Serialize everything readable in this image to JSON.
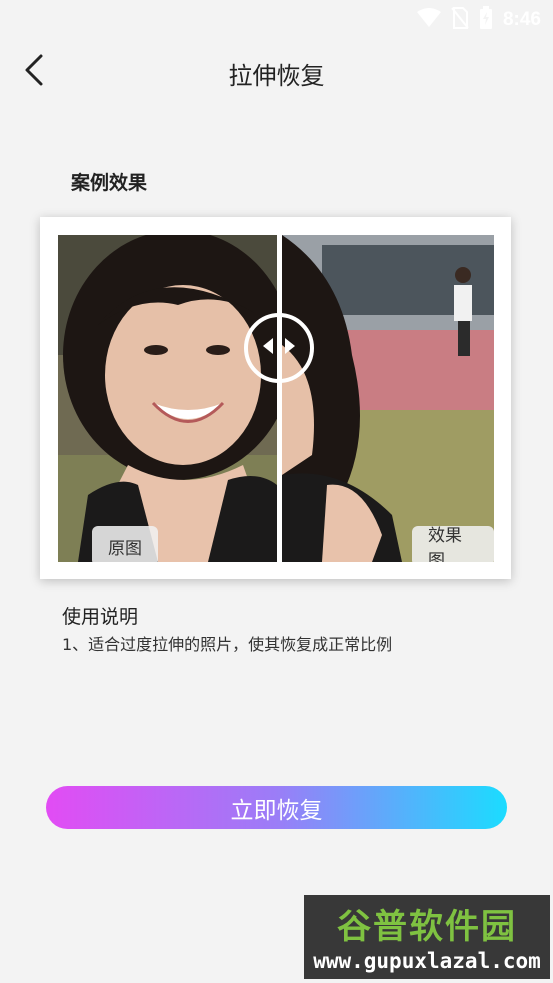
{
  "status_bar": {
    "time": "8:46",
    "icons": [
      "wifi-icon",
      "no-sim-icon",
      "battery-icon"
    ]
  },
  "header": {
    "back_icon": "chevron-left-icon",
    "title": "拉伸恢复"
  },
  "example": {
    "section_title": "案例效果",
    "original_label": "原图",
    "result_label": "效果图",
    "slider_icons": [
      "arrow-left-icon",
      "arrow-right-icon"
    ]
  },
  "usage": {
    "title": "使用说明",
    "text": "1、适合过度拉伸的照片，使其恢复成正常比例"
  },
  "action": {
    "restore_label": "立即恢复",
    "gradient": [
      "#e24cf4",
      "#9b7df7",
      "#1bdcff"
    ]
  },
  "watermark": {
    "logo_text": "谷普软件园",
    "url": "www.gupuxlazal.com"
  }
}
